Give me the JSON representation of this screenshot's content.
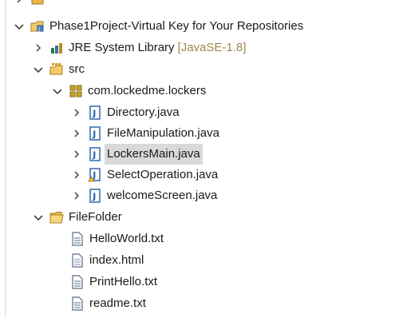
{
  "tree": {
    "project": {
      "label": "Phase1Project-Virtual Key for Your Repositories"
    },
    "jre": {
      "label": "JRE System Library",
      "decoration": "[JavaSE-1.8]"
    },
    "src": {
      "label": "src"
    },
    "package": {
      "label": "com.lockedme.lockers"
    },
    "files": [
      {
        "label": "Directory.java"
      },
      {
        "label": "FileManipulation.java"
      },
      {
        "label": "LockersMain.java"
      },
      {
        "label": "SelectOperation.java"
      },
      {
        "label": "welcomeScreen.java"
      }
    ],
    "folder": {
      "label": "FileFolder"
    },
    "folder_files": [
      {
        "label": "HelloWorld.txt"
      },
      {
        "label": "index.html"
      },
      {
        "label": "PrintHello.txt"
      },
      {
        "label": "readme.txt"
      }
    ]
  },
  "colors": {
    "selection": "#d9d9d9",
    "decoration": "#9a8a4a",
    "java_icon": "#1f5fa8",
    "folder": "#e8b84a",
    "package": "#c9a227"
  }
}
